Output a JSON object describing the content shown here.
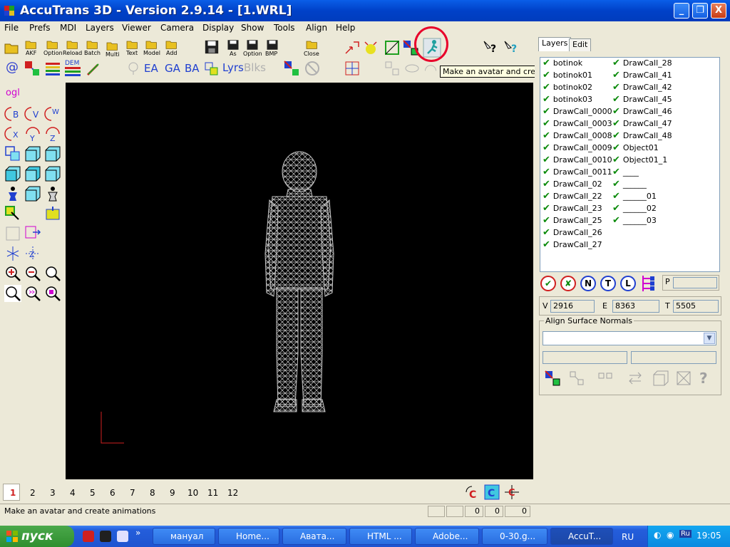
{
  "window": {
    "title": "AccuTrans 3D - Version 2.9.14 - [1.WRL]",
    "controls": [
      "_",
      "❐",
      "X"
    ]
  },
  "menu": [
    "File",
    "Prefs",
    "MDI",
    "Layers",
    "Viewer",
    "Camera",
    "Display",
    "Show",
    "Tools",
    "Align",
    "Help"
  ],
  "toolbar": {
    "row1_labels": [
      "AKF",
      "Option",
      "Reload",
      "Batch",
      "Multi",
      "Text",
      "Model",
      "Add",
      "As",
      "Option",
      "BMP",
      "Close"
    ],
    "row2_text_buttons": [
      "@",
      "EA",
      "GA",
      "BA",
      "Lyrs",
      "Blks"
    ]
  },
  "tooltip": "Make an avatar and create animations",
  "left_tools": {
    "ogl_label": "ogl",
    "rotate_buttons": [
      "B",
      "V",
      "W",
      "X",
      "Y",
      "Z"
    ]
  },
  "panel": {
    "tabs": [
      "Layers",
      "Edit"
    ],
    "layers_col1": [
      "botinok",
      "botinok01",
      "botinok02",
      "botinok03",
      "DrawCall_0000",
      "DrawCall_0003",
      "DrawCall_0008",
      "DrawCall_0009",
      "DrawCall_0010",
      "DrawCall_0011",
      "DrawCall_02",
      "DrawCall_22",
      "DrawCall_23",
      "DrawCall_25",
      "DrawCall_26",
      "DrawCall_27"
    ],
    "layers_col2": [
      "DrawCall_28",
      "DrawCall_41",
      "DrawCall_42",
      "DrawCall_45",
      "DrawCall_46",
      "DrawCall_47",
      "DrawCall_48",
      "Object01",
      "Object01_1",
      "____",
      "______",
      "______01",
      "______02",
      "______03"
    ],
    "round_buttons": [
      "N",
      "T",
      "L"
    ],
    "p_label": "P",
    "stats": {
      "v_label": "V",
      "v": "2916",
      "e_label": "E",
      "e": "8363",
      "t_label": "T",
      "t": "5505"
    },
    "align_group": "Align Surface Normals"
  },
  "bottom": {
    "pages": [
      "1",
      "2",
      "3",
      "4",
      "5",
      "6",
      "7",
      "8",
      "9",
      "10",
      "11",
      "12"
    ],
    "status_text": "Make an avatar and create animations",
    "status_values": [
      "0",
      "0",
      "0"
    ]
  },
  "taskbar": {
    "start": "пуск",
    "tasks": [
      "мануал",
      "Home...",
      "Авата...",
      "HTML ...",
      "Adobe...",
      "0-30.g...",
      "AccuT..."
    ],
    "lang": "RU",
    "tray_lang": "Ru",
    "clock": "19:05"
  },
  "colors": {
    "title_blue": "#0a5ee8",
    "check_green": "#0a8a0a",
    "highlight_red": "#e8002a",
    "viewport_bg": "#000000",
    "mesh": "#c8c8c8"
  }
}
